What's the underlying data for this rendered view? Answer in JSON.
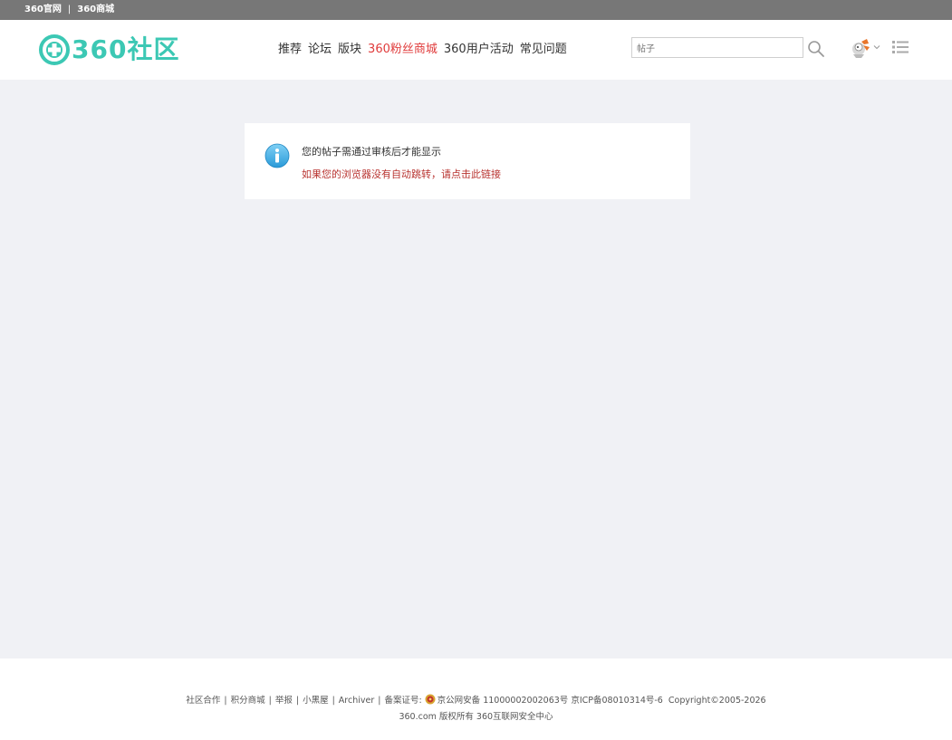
{
  "topbar": {
    "links": [
      "360官网",
      "360商城"
    ],
    "separator": "|"
  },
  "header": {
    "logo_text": "360社区",
    "nav": [
      {
        "label": "推荐",
        "highlight": false
      },
      {
        "label": "论坛",
        "highlight": false
      },
      {
        "label": "版块",
        "highlight": false
      },
      {
        "label": "360粉丝商城",
        "highlight": true
      },
      {
        "label": "360用户活动",
        "highlight": false
      },
      {
        "label": "常见问题",
        "highlight": false
      }
    ],
    "search": {
      "placeholder": "帖子",
      "value": ""
    }
  },
  "notice": {
    "message": "您的帖子需通过审核后才能显示",
    "redirect": "如果您的浏览器没有自动跳转，请点击此链接"
  },
  "footer": {
    "links": [
      "社区合作",
      "积分商城",
      "举报",
      "小黑屋",
      "Archiver"
    ],
    "record_label": "备案证号:",
    "police_record": "京公网安备 11000002002063号",
    "icp": "京ICP备08010314号-6",
    "copyright": "Copyright©2005-2026",
    "rights": "360.com 版权所有 360互联网安全中心"
  },
  "colors": {
    "brand": "#3cc8b4",
    "highlight": "#e03b3b",
    "redirect": "#b8332f",
    "topbar": "#777777",
    "page_bg": "#f0f1f5"
  }
}
